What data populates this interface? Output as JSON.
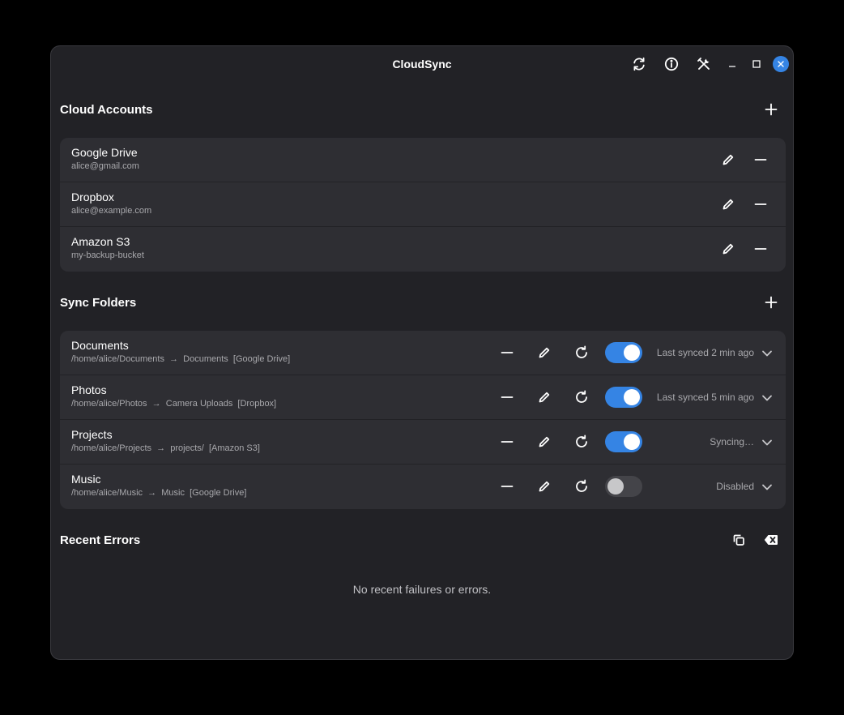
{
  "app": {
    "title": "CloudSync"
  },
  "header": {
    "buttons": [
      {
        "name": "sync-all-button",
        "icon": "refresh-arrows-icon"
      },
      {
        "name": "about-button",
        "icon": "info-icon"
      },
      {
        "name": "preferences-button",
        "icon": "tools-icon"
      }
    ]
  },
  "accounts": {
    "title": "Cloud Accounts",
    "items": [
      {
        "name": "Google Drive",
        "detail": "alice@gmail.com"
      },
      {
        "name": "Dropbox",
        "detail": "alice@example.com"
      },
      {
        "name": "Amazon S3",
        "detail": "my-backup-bucket"
      }
    ]
  },
  "folders": {
    "title": "Sync Folders",
    "items": [
      {
        "name": "Documents",
        "path": "/home/alice/Documents  →  Documents  [Google Drive]",
        "enabled": true,
        "status": "Last synced 2 min ago"
      },
      {
        "name": "Photos",
        "path": "/home/alice/Photos  →  Camera Uploads  [Dropbox]",
        "enabled": true,
        "status": "Last synced 5 min ago"
      },
      {
        "name": "Projects",
        "path": "/home/alice/Projects  →  projects/  [Amazon S3]",
        "enabled": true,
        "status": "Syncing…"
      },
      {
        "name": "Music",
        "path": "/home/alice/Music  →  Music  [Google Drive]",
        "enabled": false,
        "status": "Disabled"
      }
    ]
  },
  "errors": {
    "title": "Recent Errors",
    "empty_text": "No recent failures or errors."
  },
  "colors": {
    "accent": "#3584e4",
    "window_bg": "#222226",
    "row_bg": "#2e2e33",
    "dim_text": "#a8a8ac"
  }
}
